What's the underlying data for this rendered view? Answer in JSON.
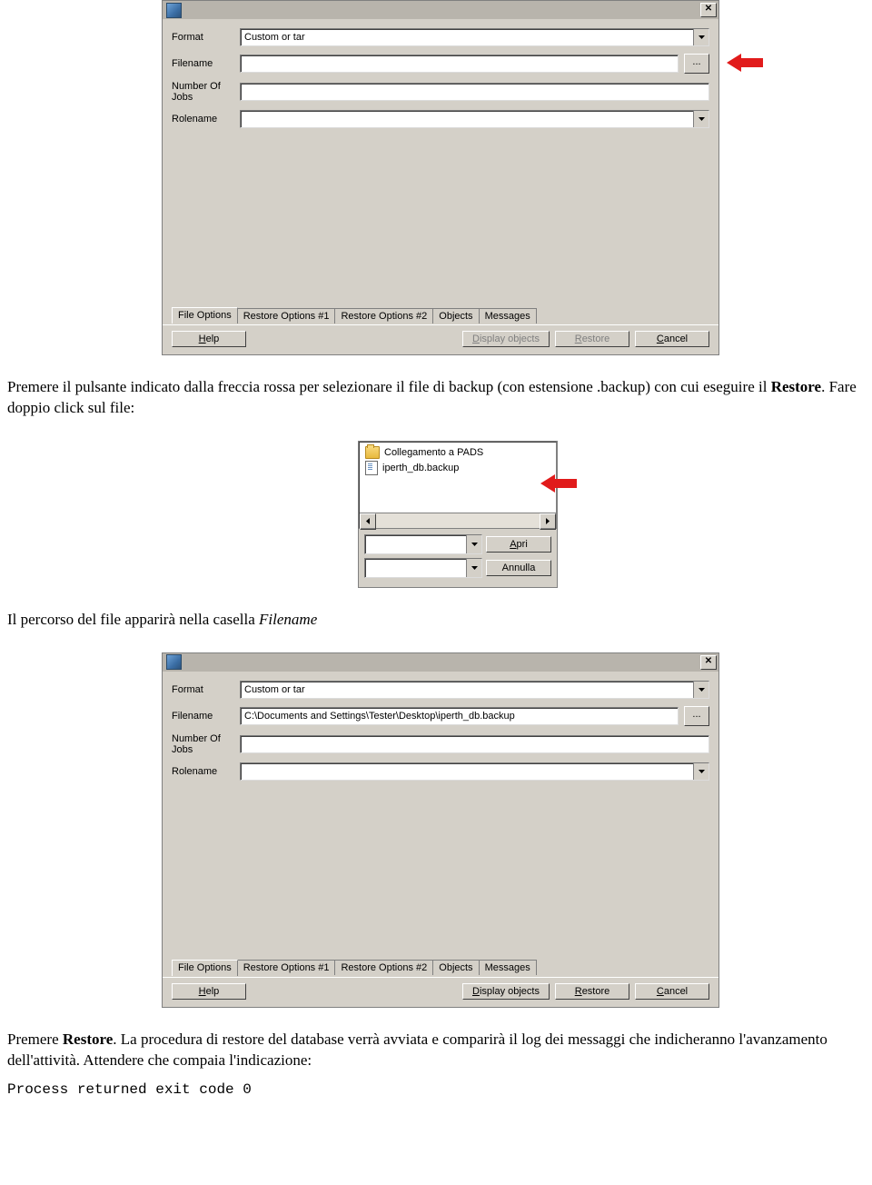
{
  "dialog1": {
    "labels": {
      "format": "Format",
      "filename": "Filename",
      "jobs": "Number Of Jobs",
      "rolename": "Rolename"
    },
    "format_value": "Custom or tar",
    "filename_value": "",
    "jobs_value": "",
    "rolename_value": "",
    "browse": "...",
    "tabs": {
      "file_options": "File Options",
      "ro1": "Restore Options #1",
      "ro2": "Restore Options #2",
      "objects": "Objects",
      "messages": "Messages"
    },
    "buttons": {
      "help": "Help",
      "display": "Display objects",
      "restore": "Restore",
      "cancel": "Cancel"
    }
  },
  "text1": {
    "p1a": "Premere il pulsante indicato dalla freccia rossa per selezionare il file di backup (con estensione .backup) con cui eseguire il ",
    "p1b": "Restore",
    "p1c": ". Fare doppio click sul file:"
  },
  "file_dialog": {
    "items": [
      {
        "icon": "folder",
        "label": "Collegamento a PADS"
      },
      {
        "icon": "doc",
        "label": "iperth_db.backup"
      }
    ],
    "open": "Apri",
    "cancel": "Annulla"
  },
  "text2": {
    "p1a": "Il percorso del file apparirà nella casella ",
    "p1b": "Filename"
  },
  "dialog2": {
    "labels": {
      "format": "Format",
      "filename": "Filename",
      "jobs": "Number Of Jobs",
      "rolename": "Rolename"
    },
    "format_value": "Custom or tar",
    "filename_value": "C:\\Documents and Settings\\Tester\\Desktop\\iperth_db.backup",
    "jobs_value": "",
    "rolename_value": "",
    "browse": "...",
    "tabs": {
      "file_options": "File Options",
      "ro1": "Restore Options #1",
      "ro2": "Restore Options #2",
      "objects": "Objects",
      "messages": "Messages"
    },
    "buttons": {
      "help": "Help",
      "display": "Display objects",
      "restore": "Restore",
      "cancel": "Cancel"
    }
  },
  "text3": {
    "p1a": "Premere ",
    "p1b": "Restore",
    "p1c": ". La procedura di restore del database verrà avviata  e comparirà il log dei messaggi che indicheranno l'avanzamento dell'attività. Attendere che compaia l'indicazione:",
    "code": "Process returned exit code 0"
  }
}
